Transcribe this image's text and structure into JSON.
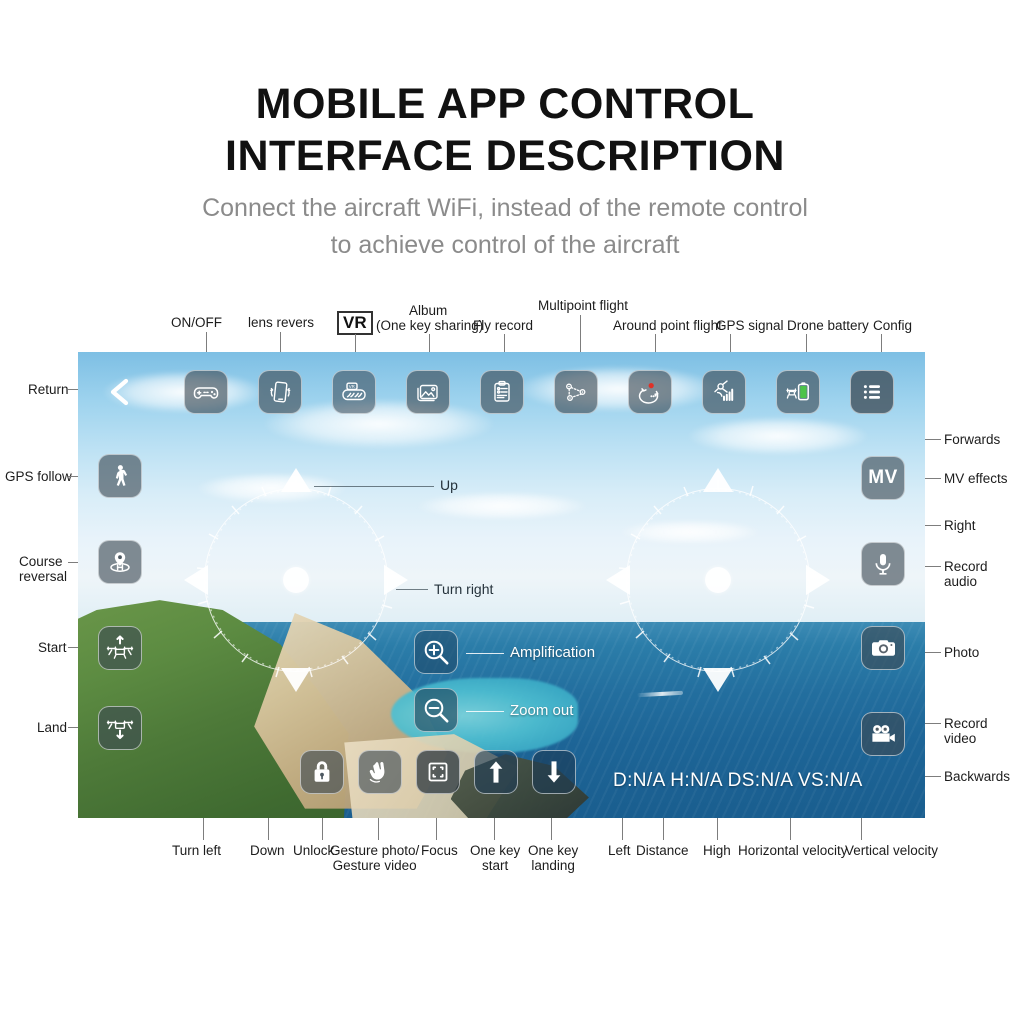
{
  "heading": {
    "title_line1": "MOBILE APP CONTROL",
    "title_line2": "INTERFACE DESCRIPTION",
    "subtitle_line1": "Connect the aircraft WiFi, instead of the remote control",
    "subtitle_line2": "to achieve control of the aircraft"
  },
  "colors": {
    "label_text": "#1c1c1c",
    "subtitle_text": "#8b8b8b",
    "leader_line": "#7d7d7d",
    "button_fill": "rgba(60,72,82,.62)",
    "button_border": "rgba(255,255,255,.55)",
    "record_dot": "#e03127",
    "battery_green": "#4cc34a"
  },
  "top_callouts": [
    {
      "label": "ON/OFF",
      "icon": "gamepad-icon"
    },
    {
      "label": "lens revers",
      "icon": "phone-tilt-icon"
    },
    {
      "label": "VR",
      "icon": "vr-goggles-icon",
      "boxed": true
    },
    {
      "label": "Album",
      "label2": "(One key sharing)",
      "icon": "album-icon"
    },
    {
      "label": "Fly record",
      "icon": "fly-record-icon"
    },
    {
      "label": "Multipoint flight",
      "icon": "multipoint-flight-icon"
    },
    {
      "label": "Around point flight",
      "icon": "around-point-flight-icon"
    },
    {
      "label": "GPS signal",
      "icon": "gps-signal-icon"
    },
    {
      "label": "Drone battery",
      "icon": "drone-battery-icon"
    },
    {
      "label": "Config",
      "icon": "config-menu-icon"
    }
  ],
  "left_callouts": [
    {
      "label": "Return",
      "icon": "back-chevron-icon"
    },
    {
      "label": "GPS follow",
      "icon": "walking-person-icon"
    },
    {
      "label": "Course reversal",
      "line1": "Course",
      "line2": "reversal",
      "icon": "home-pin-icon"
    },
    {
      "label": "Start",
      "icon": "drone-takeoff-icon"
    },
    {
      "label": "Land",
      "icon": "drone-landing-icon"
    }
  ],
  "right_callouts": [
    {
      "label": "Forwards",
      "icon": "joystick-up-arrow-icon"
    },
    {
      "label": "MV effects",
      "icon": "mv-effects-icon",
      "text": "MV"
    },
    {
      "label": "Right",
      "icon": "joystick-right-arrow-icon"
    },
    {
      "label": "Record audio",
      "line1": "Record",
      "line2": "audio",
      "icon": "microphone-icon"
    },
    {
      "label": "Photo",
      "icon": "camera-icon"
    },
    {
      "label": "Record video",
      "line1": "Record",
      "line2": "video",
      "icon": "video-camera-icon"
    },
    {
      "label": "Backwards",
      "icon": "joystick-down-arrow-icon"
    }
  ],
  "bottom_callouts": [
    {
      "label": "Turn left",
      "icon": "joystick-left-arrow-icon"
    },
    {
      "label": "Down",
      "icon": "joystick-down-arrow-icon"
    },
    {
      "label": "Unlock",
      "icon": "lock-icon"
    },
    {
      "label": "Gesture photo/ Gesture video",
      "line1": "Gesture photo/",
      "line2": "Gesture video",
      "icon": "hand-peace-icon"
    },
    {
      "label": "Focus",
      "icon": "focus-frame-icon"
    },
    {
      "label": "One key start",
      "line1": "One key",
      "line2": "start",
      "icon": "arrow-up-icon"
    },
    {
      "label": "One key landing",
      "line1": "One key",
      "line2": "landing",
      "icon": "arrow-down-icon"
    },
    {
      "label": "Left",
      "icon": "joystick-left-arrow-icon"
    },
    {
      "label": "Distance",
      "icon": "telemetry-distance"
    },
    {
      "label": "High",
      "icon": "telemetry-height"
    },
    {
      "label": "Horizontal velocity",
      "icon": "telemetry-ds"
    },
    {
      "label": "Vertical velocity",
      "icon": "telemetry-vs"
    }
  ],
  "screen_labels": {
    "up": "Up",
    "turn_right": "Turn right",
    "amplification": "Amplification",
    "zoom_out": "Zoom out"
  },
  "telemetry": {
    "distance": "D:N/A",
    "height": "H:N/A",
    "horizontal_speed": "DS:N/A",
    "vertical_speed": "VS:N/A",
    "combined": "D:N/A  H:N/A  DS:N/A  VS:N/A"
  }
}
